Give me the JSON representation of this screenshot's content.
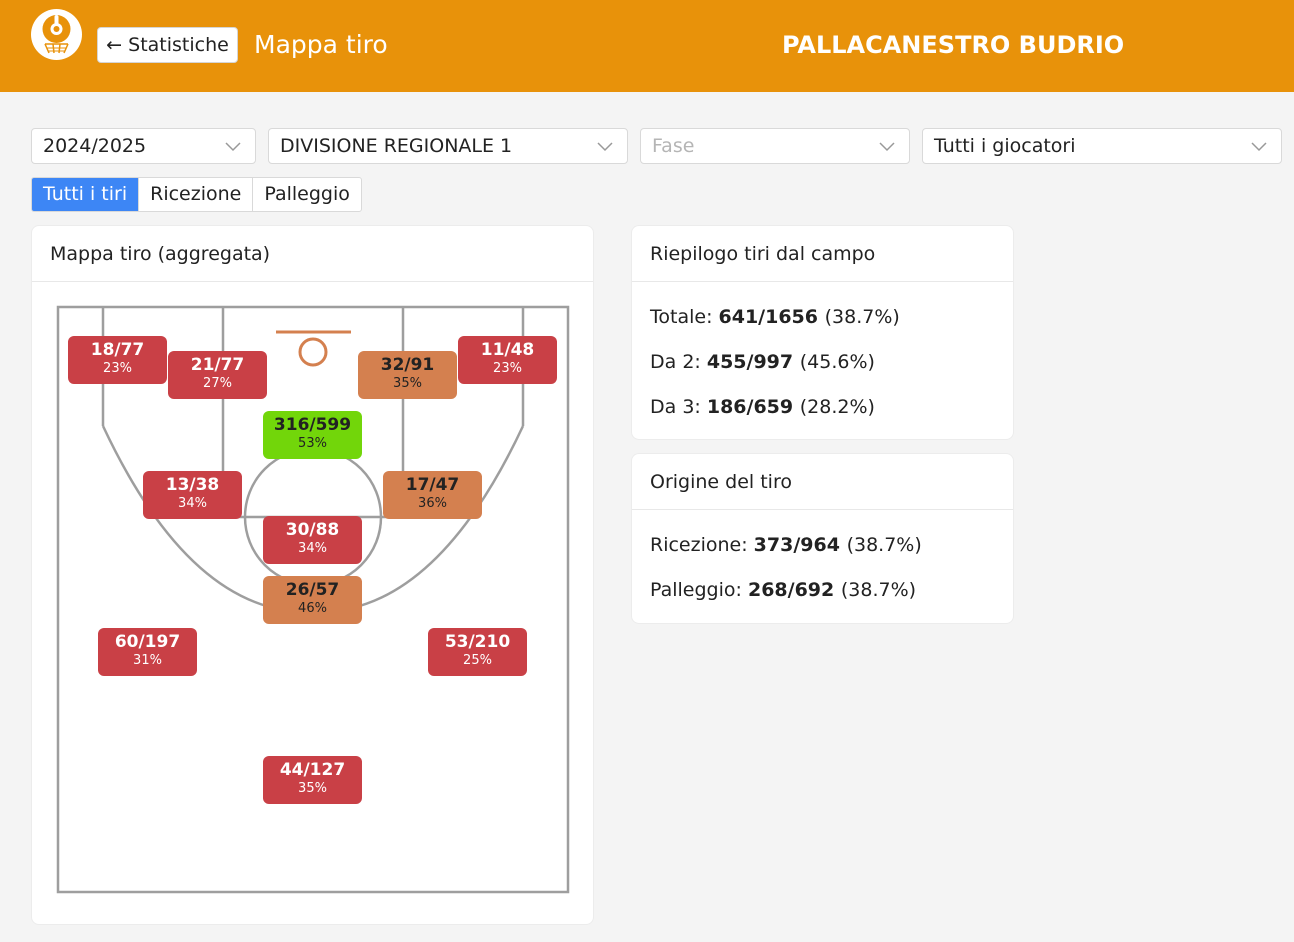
{
  "header": {
    "back_label": "← Statistiche",
    "title": "Mappa tiro",
    "team": "PALLACANESTRO BUDRIO",
    "bg_color": "#e8920a"
  },
  "filters": {
    "season": "2024/2025",
    "division": "DIVISIONE REGIONALE 1",
    "phase_placeholder": "Fase",
    "players": "Tutti i giocatori"
  },
  "tabs": [
    {
      "label": "Tutti i tiri",
      "active": true
    },
    {
      "label": "Ricezione",
      "active": false
    },
    {
      "label": "Palleggio",
      "active": false
    }
  ],
  "map_card": {
    "title": "Mappa tiro (aggregata)",
    "zones": [
      {
        "id": "corner-left",
        "made": "18/77",
        "pct": "23%",
        "color": "#c94046"
      },
      {
        "id": "wing-mid-left",
        "made": "21/77",
        "pct": "27%",
        "color": "#c94046"
      },
      {
        "id": "wing-mid-right",
        "made": "32/91",
        "pct": "35%",
        "color": "#d4804f"
      },
      {
        "id": "corner-right",
        "made": "11/48",
        "pct": "23%",
        "color": "#c94046"
      },
      {
        "id": "paint",
        "made": "316/599",
        "pct": "53%",
        "color": "#72d60a"
      },
      {
        "id": "elbow-left",
        "made": "13/38",
        "pct": "34%",
        "color": "#c94046"
      },
      {
        "id": "elbow-right",
        "made": "17/47",
        "pct": "36%",
        "color": "#d4804f"
      },
      {
        "id": "free-throw",
        "made": "30/88",
        "pct": "34%",
        "color": "#c94046"
      },
      {
        "id": "top-key",
        "made": "26/57",
        "pct": "46%",
        "color": "#d4804f"
      },
      {
        "id": "three-left",
        "made": "60/197",
        "pct": "31%",
        "color": "#c94046"
      },
      {
        "id": "three-right",
        "made": "53/210",
        "pct": "25%",
        "color": "#c94046"
      },
      {
        "id": "deep",
        "made": "44/127",
        "pct": "35%",
        "color": "#c94046"
      }
    ]
  },
  "summary_card": {
    "title": "Riepilogo tiri dal campo",
    "rows": [
      {
        "label": "Totale:",
        "value": "641/1656",
        "pct": "(38.7%)"
      },
      {
        "label": "Da 2:",
        "value": "455/997",
        "pct": "(45.6%)"
      },
      {
        "label": "Da 3:",
        "value": "186/659",
        "pct": "(28.2%)"
      }
    ]
  },
  "origin_card": {
    "title": "Origine del tiro",
    "rows": [
      {
        "label": "Ricezione:",
        "value": "373/964",
        "pct": "(38.7%)"
      },
      {
        "label": "Palleggio:",
        "value": "268/692",
        "pct": "(38.7%)"
      }
    ]
  }
}
